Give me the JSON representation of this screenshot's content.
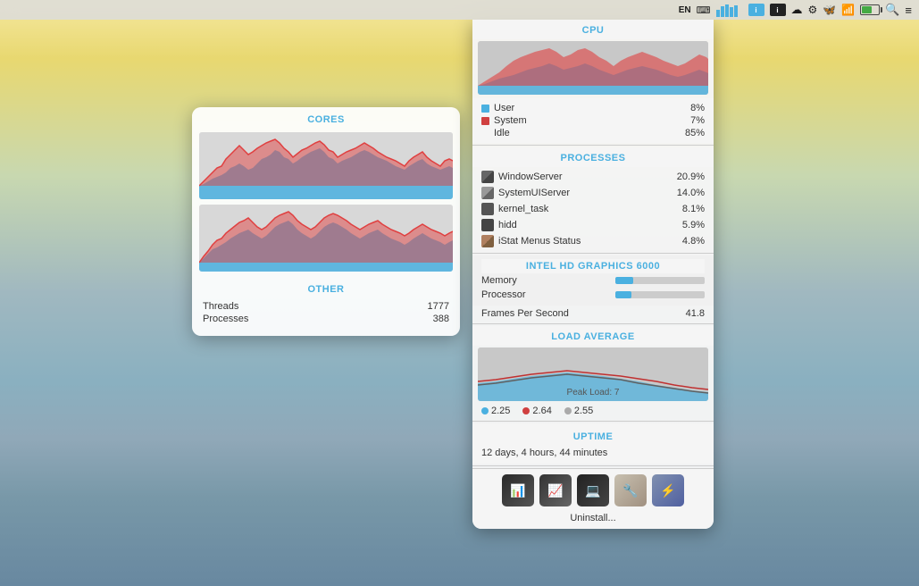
{
  "menubar": {
    "items": [
      "EN",
      "🔠",
      "📶",
      "🔋",
      "🔍",
      "≡"
    ]
  },
  "cores_panel": {
    "title": "CORES",
    "other_title": "OTHER",
    "threads_label": "Threads",
    "threads_value": "1777",
    "processes_label": "Processes",
    "processes_value": "388"
  },
  "cpu_panel": {
    "title": "CPU",
    "user_label": "User",
    "user_value": "8%",
    "system_label": "System",
    "system_value": "7%",
    "idle_label": "Idle",
    "idle_value": "85%",
    "processes_title": "PROCESSES",
    "processes": [
      {
        "name": "WindowServer",
        "value": "20.9%"
      },
      {
        "name": "SystemUIServer",
        "value": "14.0%"
      },
      {
        "name": "kernel_task",
        "value": "8.1%"
      },
      {
        "name": "hidd",
        "value": "5.9%"
      },
      {
        "name": "iStat Menus Status",
        "value": "4.8%"
      }
    ],
    "gpu_title": "INTEL HD GRAPHICS 6000",
    "memory_label": "Memory",
    "processor_label": "Processor",
    "fps_label": "Frames Per Second",
    "fps_value": "41.8",
    "load_title": "LOAD AVERAGE",
    "peak_label": "Peak Load: 7",
    "load_values": [
      {
        "color": "#4ab0e0",
        "value": "2.25"
      },
      {
        "color": "#d04040",
        "value": "2.64"
      },
      {
        "color": "#aaaaaa",
        "value": "2.55"
      }
    ],
    "uptime_title": "UPTIME",
    "uptime_value": "12 days, 4 hours, 44 minutes",
    "uninstall_label": "Uninstall..."
  },
  "icons": {
    "user_dot_color": "#4ab0e0",
    "system_dot_color": "#d04040",
    "memory_bar_pct": 20,
    "processor_bar_pct": 18
  }
}
